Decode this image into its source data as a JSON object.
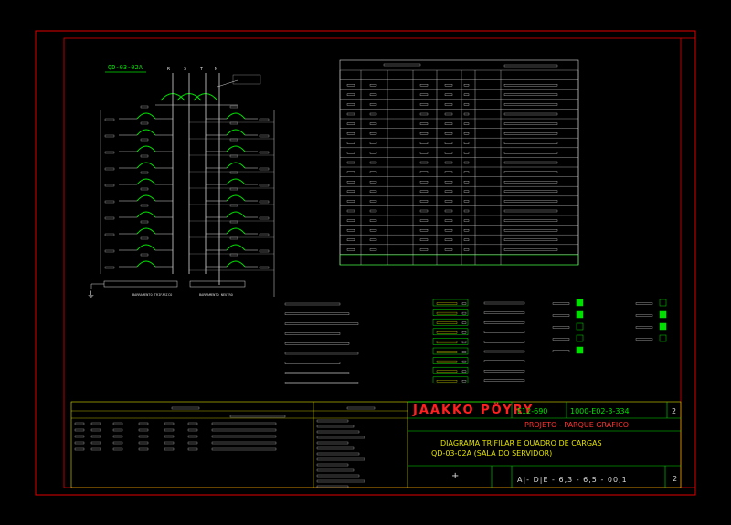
{
  "diagram_title": "QD-03-02A",
  "phase_labels": [
    "R",
    "S",
    "T",
    "N"
  ],
  "bus_labels": [
    "BARRAMENTO TRIFASICO",
    "BARRAMENTO NEUTRO"
  ],
  "ground_symbol": "⏚",
  "title_block": {
    "company": "JAAKKO PÖYRY",
    "code": "E12-690",
    "drawing_number": "1000-E02-3-334",
    "revision": "2",
    "project": "PROJETO - PARQUE GRÁFICO",
    "title_line1": "DIAGRAMA TRIFILAR E QUADRO DE CARGAS",
    "title_line2": "QD-03-02A (SALA DO SERVIDOR)",
    "bottom_code": "A|- D|E - 6,3 - 6,5 - 00,1",
    "sheet": "2",
    "plus_mark": "+"
  },
  "notes": [
    "TENSAO NOMINAL",
    "TENSAO DE COMANDO",
    "ALIMENTACAO GERAL",
    "DISJUNTOR GERAL",
    "POTENCIA TOTAL",
    "CORRENTE NOMINAL",
    "CORRENTE DE CURTO",
    "FUSIVEL",
    "OBSERVACOES GERAIS DO PROJETO"
  ],
  "notes_values": [
    "220/127 V",
    "127 V",
    "TRIFASICO",
    "50 A",
    "12,5 kW",
    "33 A",
    "5 kA",
    "--",
    "--"
  ],
  "colors": {
    "frame": "#e00000",
    "accent": "#00e000",
    "text": "#d8d8d8"
  }
}
